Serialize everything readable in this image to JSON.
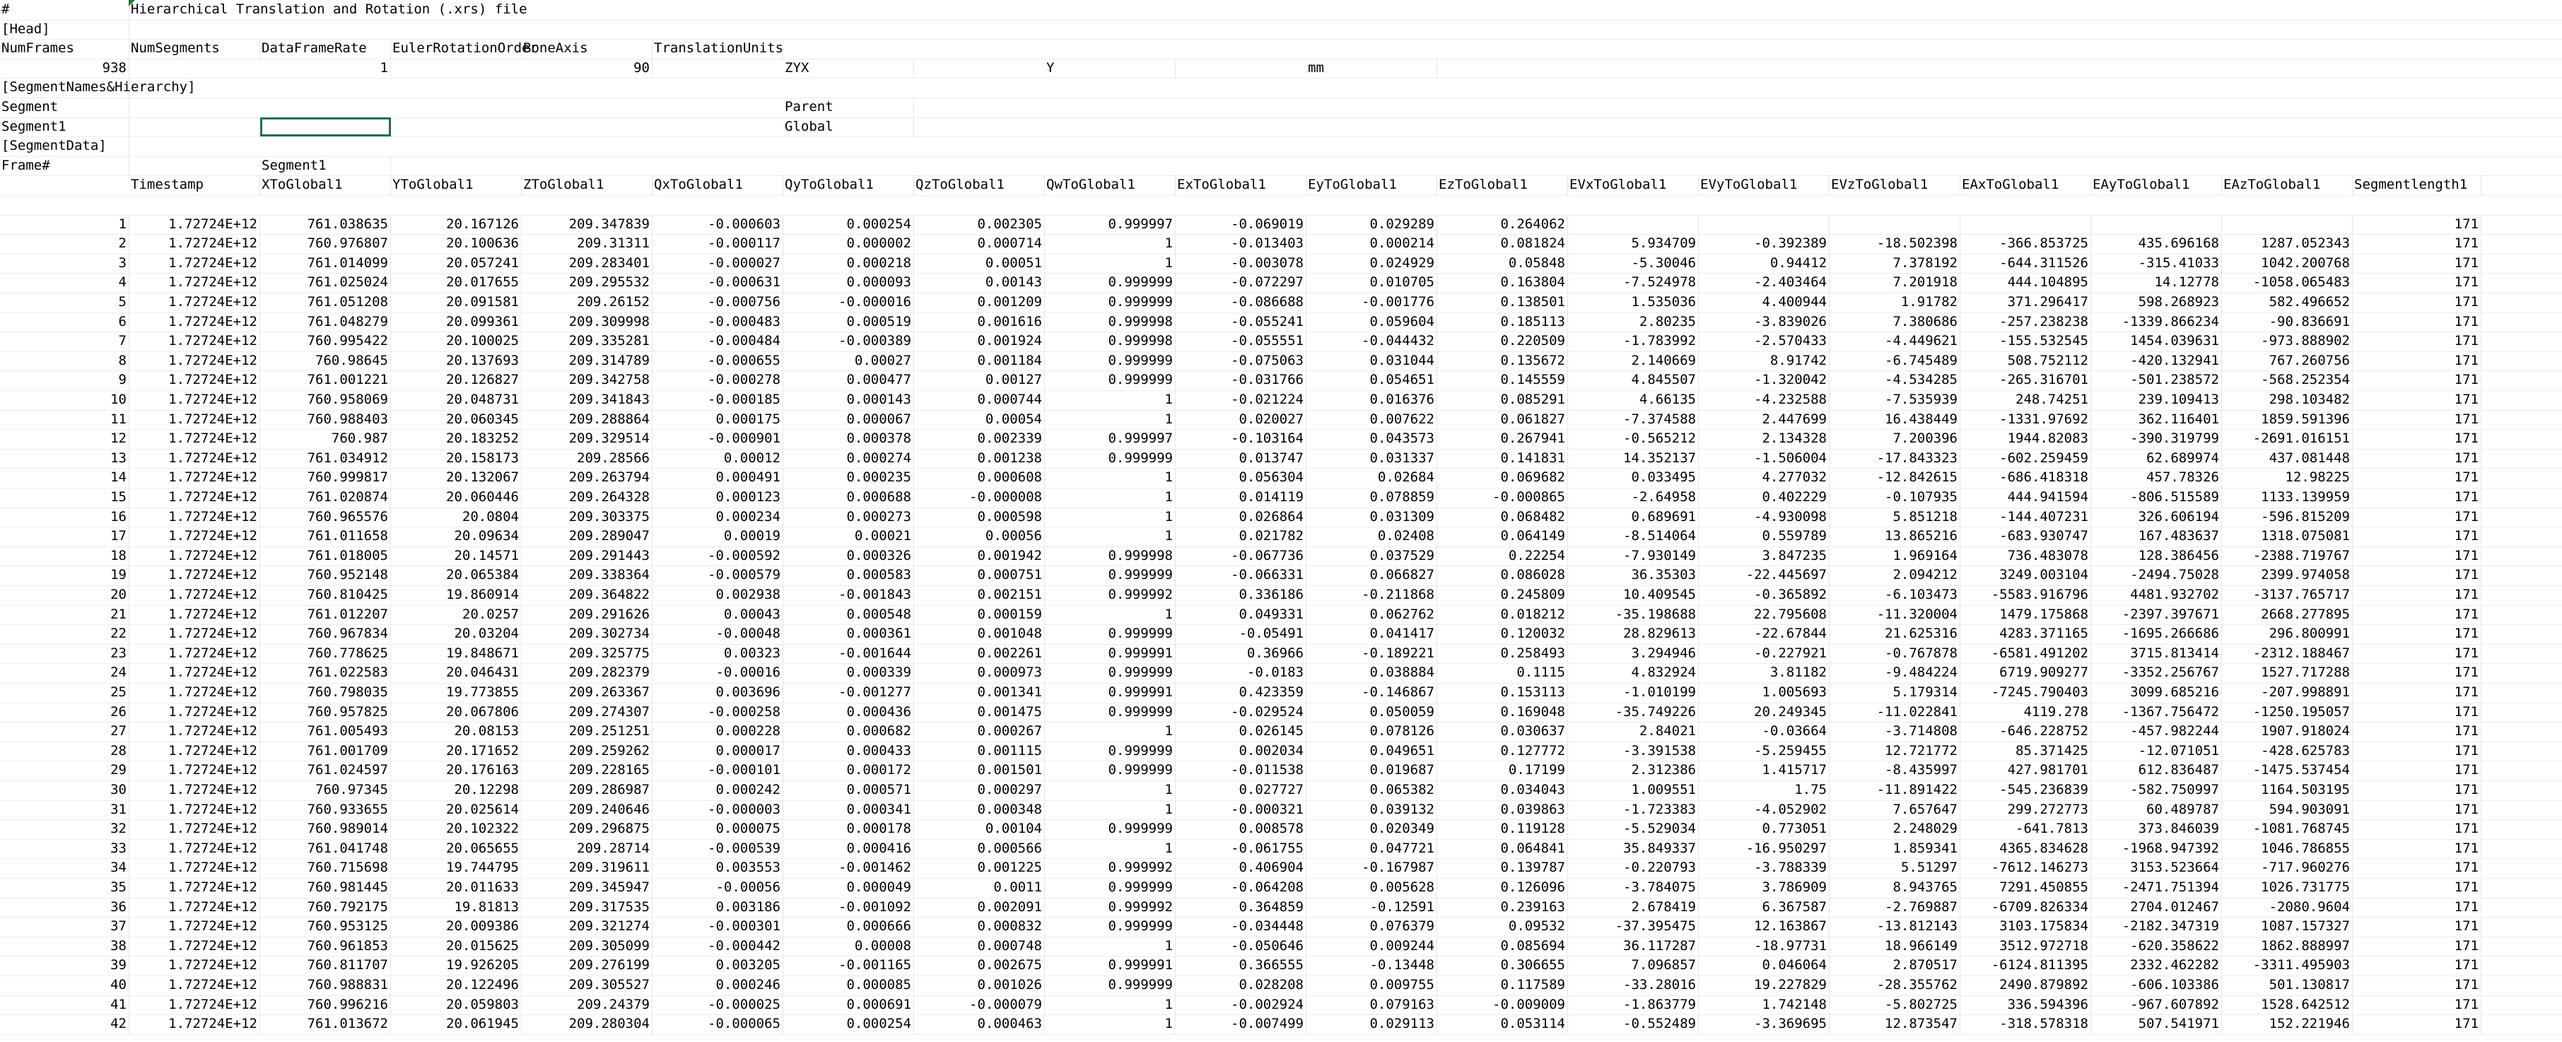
{
  "sheet": {
    "rows": [
      [
        {
          "c": 0,
          "v": "#"
        },
        {
          "c": 1,
          "v": "Hierarchical Translation and Rotation (.xrs) file"
        }
      ],
      [
        {
          "c": 0,
          "v": "[Head]"
        }
      ],
      [
        {
          "c": 0,
          "v": "NumFrames"
        },
        {
          "c": 1,
          "v": "NumSegments"
        },
        {
          "c": 2,
          "v": "DataFrameRate"
        },
        {
          "c": 3,
          "v": "EulerRotationOrder"
        },
        {
          "c": 4,
          "v": "BoneAxis"
        },
        {
          "c": 5,
          "v": "TranslationUnits"
        }
      ],
      [
        {
          "c": 0,
          "v": "938",
          "n": 1
        },
        {
          "c": 2,
          "v": "1",
          "n": 1
        },
        {
          "c": 4,
          "v": "90",
          "n": 1
        },
        {
          "c": 6,
          "v": "ZYX"
        },
        {
          "c": 8,
          "v": "Y"
        },
        {
          "c": 10,
          "v": "mm"
        }
      ],
      [
        {
          "c": 0,
          "v": "[SegmentNames&Hierarchy]"
        }
      ],
      [
        {
          "c": 0,
          "v": "Segment"
        },
        {
          "c": 6,
          "v": "Parent"
        }
      ],
      [
        {
          "c": 0,
          "v": "Segment1"
        },
        {
          "c": 6,
          "v": "Global"
        }
      ],
      [
        {
          "c": 0,
          "v": "[SegmentData]"
        }
      ],
      [
        {
          "c": 0,
          "v": "Frame#"
        },
        {
          "c": 2,
          "v": "Segment1"
        }
      ],
      [
        {
          "c": 1,
          "v": "Timestamp"
        },
        {
          "c": 2,
          "v": "XToGlobal1"
        },
        {
          "c": 3,
          "v": "YToGlobal1"
        },
        {
          "c": 4,
          "v": "ZToGlobal1"
        },
        {
          "c": 5,
          "v": "QxToGlobal1"
        },
        {
          "c": 6,
          "v": "QyToGlobal1"
        },
        {
          "c": 7,
          "v": "QzToGlobal1"
        },
        {
          "c": 8,
          "v": "QwToGlobal1"
        },
        {
          "c": 9,
          "v": "ExToGlobal1"
        },
        {
          "c": 10,
          "v": "EyToGlobal1"
        },
        {
          "c": 11,
          "v": "EzToGlobal1"
        },
        {
          "c": 12,
          "v": "EVxToGlobal1"
        },
        {
          "c": 13,
          "v": "EVyToGlobal1"
        },
        {
          "c": 14,
          "v": "EVzToGlobal1"
        },
        {
          "c": 15,
          "v": "EAxToGlobal1"
        },
        {
          "c": 16,
          "v": "EAyToGlobal1"
        },
        {
          "c": 17,
          "v": "EAzToGlobal1"
        },
        {
          "c": 18,
          "v": "Segmentlength1"
        }
      ],
      [],
      [
        "1",
        "1.72724E+12",
        "761.038635",
        "20.167126",
        "209.347839",
        "-0.000603",
        "0.000254",
        "0.002305",
        "0.999997",
        "-0.069019",
        "0.029289",
        "0.264062",
        "",
        "",
        "",
        "",
        "",
        "",
        "171"
      ],
      [
        "2",
        "1.72724E+12",
        "760.976807",
        "20.100636",
        "209.31311",
        "-0.000117",
        "0.000002",
        "0.000714",
        "1",
        "-0.013403",
        "0.000214",
        "0.081824",
        "5.934709",
        "-0.392389",
        "-18.502398",
        "-366.853725",
        "435.696168",
        "1287.052343",
        "171"
      ],
      [
        "3",
        "1.72724E+12",
        "761.014099",
        "20.057241",
        "209.283401",
        "-0.000027",
        "0.000218",
        "0.00051",
        "1",
        "-0.003078",
        "0.024929",
        "0.05848",
        "-5.30046",
        "0.94412",
        "7.378192",
        "-644.311526",
        "-315.41033",
        "1042.200768",
        "171"
      ],
      [
        "4",
        "1.72724E+12",
        "761.025024",
        "20.017655",
        "209.295532",
        "-0.000631",
        "0.000093",
        "0.00143",
        "0.999999",
        "-0.072297",
        "0.010705",
        "0.163804",
        "-7.524978",
        "-2.403464",
        "7.201918",
        "444.104895",
        "14.12778",
        "-1058.065483",
        "171"
      ],
      [
        "5",
        "1.72724E+12",
        "761.051208",
        "20.091581",
        "209.26152",
        "-0.000756",
        "-0.000016",
        "0.001209",
        "0.999999",
        "-0.086688",
        "-0.001776",
        "0.138501",
        "1.535036",
        "4.400944",
        "1.91782",
        "371.296417",
        "598.268923",
        "582.496652",
        "171"
      ],
      [
        "6",
        "1.72724E+12",
        "761.048279",
        "20.099361",
        "209.309998",
        "-0.000483",
        "0.000519",
        "0.001616",
        "0.999998",
        "-0.055241",
        "0.059604",
        "0.185113",
        "2.80235",
        "-3.839026",
        "7.380686",
        "-257.238238",
        "-1339.866234",
        "-90.836691",
        "171"
      ],
      [
        "7",
        "1.72724E+12",
        "760.995422",
        "20.100025",
        "209.335281",
        "-0.000484",
        "-0.000389",
        "0.001924",
        "0.999998",
        "-0.055551",
        "-0.044432",
        "0.220509",
        "-1.783992",
        "-2.570433",
        "-4.449621",
        "-155.532545",
        "1454.039631",
        "-973.888902",
        "171"
      ],
      [
        "8",
        "1.72724E+12",
        "760.98645",
        "20.137693",
        "209.314789",
        "-0.000655",
        "0.00027",
        "0.001184",
        "0.999999",
        "-0.075063",
        "0.031044",
        "0.135672",
        "2.140669",
        "8.91742",
        "-6.745489",
        "508.752112",
        "-420.132941",
        "767.260756",
        "171"
      ],
      [
        "9",
        "1.72724E+12",
        "761.001221",
        "20.126827",
        "209.342758",
        "-0.000278",
        "0.000477",
        "0.00127",
        "0.999999",
        "-0.031766",
        "0.054651",
        "0.145559",
        "4.845507",
        "-1.320042",
        "-4.534285",
        "-265.316701",
        "-501.238572",
        "-568.252354",
        "171"
      ],
      [
        "10",
        "1.72724E+12",
        "760.958069",
        "20.048731",
        "209.341843",
        "-0.000185",
        "0.000143",
        "0.000744",
        "1",
        "-0.021224",
        "0.016376",
        "0.085291",
        "4.66135",
        "-4.232588",
        "-7.535939",
        "248.74251",
        "239.109413",
        "298.103482",
        "171"
      ],
      [
        "11",
        "1.72724E+12",
        "760.988403",
        "20.060345",
        "209.288864",
        "0.000175",
        "0.000067",
        "0.00054",
        "1",
        "0.020027",
        "0.007622",
        "0.061827",
        "-7.374588",
        "2.447699",
        "16.438449",
        "-1331.97692",
        "362.116401",
        "1859.591396",
        "171"
      ],
      [
        "12",
        "1.72724E+12",
        "760.987",
        "20.183252",
        "209.329514",
        "-0.000901",
        "0.000378",
        "0.002339",
        "0.999997",
        "-0.103164",
        "0.043573",
        "0.267941",
        "-0.565212",
        "2.134328",
        "7.200396",
        "1944.82083",
        "-390.319799",
        "-2691.016151",
        "171"
      ],
      [
        "13",
        "1.72724E+12",
        "761.034912",
        "20.158173",
        "209.28566",
        "0.00012",
        "0.000274",
        "0.001238",
        "0.999999",
        "0.013747",
        "0.031337",
        "0.141831",
        "14.352137",
        "-1.506004",
        "-17.843323",
        "-602.259459",
        "62.689974",
        "437.081448",
        "171"
      ],
      [
        "14",
        "1.72724E+12",
        "760.999817",
        "20.132067",
        "209.263794",
        "0.000491",
        "0.000235",
        "0.000608",
        "1",
        "0.056304",
        "0.02684",
        "0.069682",
        "0.033495",
        "4.277032",
        "-12.842615",
        "-686.418318",
        "457.78326",
        "12.98225",
        "171"
      ],
      [
        "15",
        "1.72724E+12",
        "761.020874",
        "20.060446",
        "209.264328",
        "0.000123",
        "0.000688",
        "-0.000008",
        "1",
        "0.014119",
        "0.078859",
        "-0.000865",
        "-2.64958",
        "0.402229",
        "-0.107935",
        "444.941594",
        "-806.515589",
        "1133.139959",
        "171"
      ],
      [
        "16",
        "1.72724E+12",
        "760.965576",
        "20.0804",
        "209.303375",
        "0.000234",
        "0.000273",
        "0.000598",
        "1",
        "0.026864",
        "0.031309",
        "0.068482",
        "0.689691",
        "-4.930098",
        "5.851218",
        "-144.407231",
        "326.606194",
        "-596.815209",
        "171"
      ],
      [
        "17",
        "1.72724E+12",
        "761.011658",
        "20.09634",
        "209.289047",
        "0.00019",
        "0.00021",
        "0.00056",
        "1",
        "0.021782",
        "0.02408",
        "0.064149",
        "-8.514064",
        "0.559789",
        "13.865216",
        "-683.930747",
        "167.483637",
        "1318.075081",
        "171"
      ],
      [
        "18",
        "1.72724E+12",
        "761.018005",
        "20.14571",
        "209.291443",
        "-0.000592",
        "0.000326",
        "0.001942",
        "0.999998",
        "-0.067736",
        "0.037529",
        "0.22254",
        "-7.930149",
        "3.847235",
        "1.969164",
        "736.483078",
        "128.386456",
        "-2388.719767",
        "171"
      ],
      [
        "19",
        "1.72724E+12",
        "760.952148",
        "20.065384",
        "209.338364",
        "-0.000579",
        "0.000583",
        "0.000751",
        "0.999999",
        "-0.066331",
        "0.066827",
        "0.086028",
        "36.35303",
        "-22.445697",
        "2.094212",
        "3249.003104",
        "-2494.75028",
        "2399.974058",
        "171"
      ],
      [
        "20",
        "1.72724E+12",
        "760.810425",
        "19.860914",
        "209.364822",
        "0.002938",
        "-0.001843",
        "0.002151",
        "0.999992",
        "0.336186",
        "-0.211868",
        "0.245809",
        "10.409545",
        "-0.365892",
        "-6.103473",
        "-5583.916796",
        "4481.932702",
        "-3137.765717",
        "171"
      ],
      [
        "21",
        "1.72724E+12",
        "761.012207",
        "20.0257",
        "209.291626",
        "0.00043",
        "0.000548",
        "0.000159",
        "1",
        "0.049331",
        "0.062762",
        "0.018212",
        "-35.198688",
        "22.795608",
        "-11.320004",
        "1479.175868",
        "-2397.397671",
        "2668.277895",
        "171"
      ],
      [
        "22",
        "1.72724E+12",
        "760.967834",
        "20.03204",
        "209.302734",
        "-0.00048",
        "0.000361",
        "0.001048",
        "0.999999",
        "-0.05491",
        "0.041417",
        "0.120032",
        "28.829613",
        "-22.67844",
        "21.625316",
        "4283.371165",
        "-1695.266686",
        "296.800991",
        "171"
      ],
      [
        "23",
        "1.72724E+12",
        "760.778625",
        "19.848671",
        "209.325775",
        "0.00323",
        "-0.001644",
        "0.002261",
        "0.999991",
        "0.36966",
        "-0.189221",
        "0.258493",
        "3.294946",
        "-0.227921",
        "-0.767878",
        "-6581.491202",
        "3715.813414",
        "-2312.188467",
        "171"
      ],
      [
        "24",
        "1.72724E+12",
        "761.022583",
        "20.046431",
        "209.282379",
        "-0.00016",
        "0.000339",
        "0.000973",
        "0.999999",
        "-0.0183",
        "0.038884",
        "0.1115",
        "4.832924",
        "3.81182",
        "-9.484224",
        "6719.909277",
        "-3352.256767",
        "1527.717288",
        "171"
      ],
      [
        "25",
        "1.72724E+12",
        "760.798035",
        "19.773855",
        "209.263367",
        "0.003696",
        "-0.001277",
        "0.001341",
        "0.999991",
        "0.423359",
        "-0.146867",
        "0.153113",
        "-1.010199",
        "1.005693",
        "5.179314",
        "-7245.790403",
        "3099.685216",
        "-207.998891",
        "171"
      ],
      [
        "26",
        "1.72724E+12",
        "760.957825",
        "20.067806",
        "209.274307",
        "-0.000258",
        "0.000436",
        "0.001475",
        "0.999999",
        "-0.029524",
        "0.050059",
        "0.169048",
        "-35.749226",
        "20.249345",
        "-11.022841",
        "4119.278",
        "-1367.756472",
        "-1250.195057",
        "171"
      ],
      [
        "27",
        "1.72724E+12",
        "761.005493",
        "20.08153",
        "209.251251",
        "0.000228",
        "0.000682",
        "0.000267",
        "1",
        "0.026145",
        "0.078126",
        "0.030637",
        "2.84021",
        "-0.03664",
        "-3.714808",
        "-646.228752",
        "-457.982244",
        "1907.918024",
        "171"
      ],
      [
        "28",
        "1.72724E+12",
        "761.001709",
        "20.171652",
        "209.259262",
        "0.000017",
        "0.000433",
        "0.001115",
        "0.999999",
        "0.002034",
        "0.049651",
        "0.127772",
        "-3.391538",
        "-5.259455",
        "12.721772",
        "85.371425",
        "-12.071051",
        "-428.625783",
        "171"
      ],
      [
        "29",
        "1.72724E+12",
        "761.024597",
        "20.176163",
        "209.228165",
        "-0.000101",
        "0.000172",
        "0.001501",
        "0.999999",
        "-0.011538",
        "0.019687",
        "0.17199",
        "2.312386",
        "1.415717",
        "-8.435997",
        "427.981701",
        "612.836487",
        "-1475.537454",
        "171"
      ],
      [
        "30",
        "1.72724E+12",
        "760.97345",
        "20.12298",
        "209.286987",
        "0.000242",
        "0.000571",
        "0.000297",
        "1",
        "0.027727",
        "0.065382",
        "0.034043",
        "1.009551",
        "1.75",
        "-11.891422",
        "-545.236839",
        "-582.750997",
        "1164.503195",
        "171"
      ],
      [
        "31",
        "1.72724E+12",
        "760.933655",
        "20.025614",
        "209.240646",
        "-0.000003",
        "0.000341",
        "0.000348",
        "1",
        "-0.000321",
        "0.039132",
        "0.039863",
        "-1.723383",
        "-4.052902",
        "7.657647",
        "299.272773",
        "60.489787",
        "594.903091",
        "171"
      ],
      [
        "32",
        "1.72724E+12",
        "760.989014",
        "20.102322",
        "209.296875",
        "0.000075",
        "0.000178",
        "0.00104",
        "0.999999",
        "0.008578",
        "0.020349",
        "0.119128",
        "-5.529034",
        "0.773051",
        "2.248029",
        "-641.7813",
        "373.846039",
        "-1081.768745",
        "171"
      ],
      [
        "33",
        "1.72724E+12",
        "761.041748",
        "20.065655",
        "209.28714",
        "-0.000539",
        "0.000416",
        "0.000566",
        "1",
        "-0.061755",
        "0.047721",
        "0.064841",
        "35.849337",
        "-16.950297",
        "1.859341",
        "4365.834628",
        "-1968.947392",
        "1046.786855",
        "171"
      ],
      [
        "34",
        "1.72724E+12",
        "760.715698",
        "19.744795",
        "209.319611",
        "0.003553",
        "-0.001462",
        "0.001225",
        "0.999992",
        "0.406904",
        "-0.167987",
        "0.139787",
        "-0.220793",
        "-3.788339",
        "5.51297",
        "-7612.146273",
        "3153.523664",
        "-717.960276",
        "171"
      ],
      [
        "35",
        "1.72724E+12",
        "760.981445",
        "20.011633",
        "209.345947",
        "-0.00056",
        "0.000049",
        "0.0011",
        "0.999999",
        "-0.064208",
        "0.005628",
        "0.126096",
        "-3.784075",
        "3.786909",
        "8.943765",
        "7291.450855",
        "-2471.751394",
        "1026.731775",
        "171"
      ],
      [
        "36",
        "1.72724E+12",
        "760.792175",
        "19.81813",
        "209.317535",
        "0.003186",
        "-0.001092",
        "0.002091",
        "0.999992",
        "0.364859",
        "-0.12591",
        "0.239163",
        "2.678419",
        "6.367587",
        "-2.769887",
        "-6709.826334",
        "2704.012467",
        "-2080.9604",
        "171"
      ],
      [
        "37",
        "1.72724E+12",
        "760.953125",
        "20.009386",
        "209.321274",
        "-0.000301",
        "0.000666",
        "0.000832",
        "0.999999",
        "-0.034448",
        "0.076379",
        "0.09532",
        "-37.395475",
        "12.163867",
        "-13.812143",
        "3103.175834",
        "-2182.347319",
        "1087.157327",
        "171"
      ],
      [
        "38",
        "1.72724E+12",
        "760.961853",
        "20.015625",
        "209.305099",
        "-0.000442",
        "0.00008",
        "0.000748",
        "1",
        "-0.050646",
        "0.009244",
        "0.085694",
        "36.117287",
        "-18.97731",
        "18.966149",
        "3512.972718",
        "-620.358622",
        "1862.888997",
        "171"
      ],
      [
        "39",
        "1.72724E+12",
        "760.811707",
        "19.926205",
        "209.276199",
        "0.003205",
        "-0.001165",
        "0.002675",
        "0.999991",
        "0.366555",
        "-0.13448",
        "0.306655",
        "7.096857",
        "0.046064",
        "2.870517",
        "-6124.811395",
        "2332.462282",
        "-3311.495903",
        "171"
      ],
      [
        "40",
        "1.72724E+12",
        "760.988831",
        "20.122496",
        "209.305527",
        "0.000246",
        "0.000085",
        "0.001026",
        "0.999999",
        "0.028208",
        "0.009755",
        "0.117589",
        "-33.28016",
        "19.227829",
        "-28.355762",
        "2490.879892",
        "-606.103386",
        "501.130817",
        "171"
      ],
      [
        "41",
        "1.72724E+12",
        "760.996216",
        "20.059803",
        "209.24379",
        "-0.000025",
        "0.000691",
        "-0.000079",
        "1",
        "-0.002924",
        "0.079163",
        "-0.009009",
        "-1.863779",
        "1.742148",
        "-5.802725",
        "336.594396",
        "-967.607892",
        "1528.642512",
        "171"
      ],
      [
        "42",
        "1.72724E+12",
        "761.013672",
        "20.061945",
        "209.280304",
        "-0.000065",
        "0.000254",
        "0.000463",
        "1",
        "-0.007499",
        "0.029113",
        "0.053114",
        "-0.552489",
        "-3.369695",
        "12.873547",
        "-318.578318",
        "507.541971",
        "152.221946",
        "171"
      ]
    ]
  }
}
